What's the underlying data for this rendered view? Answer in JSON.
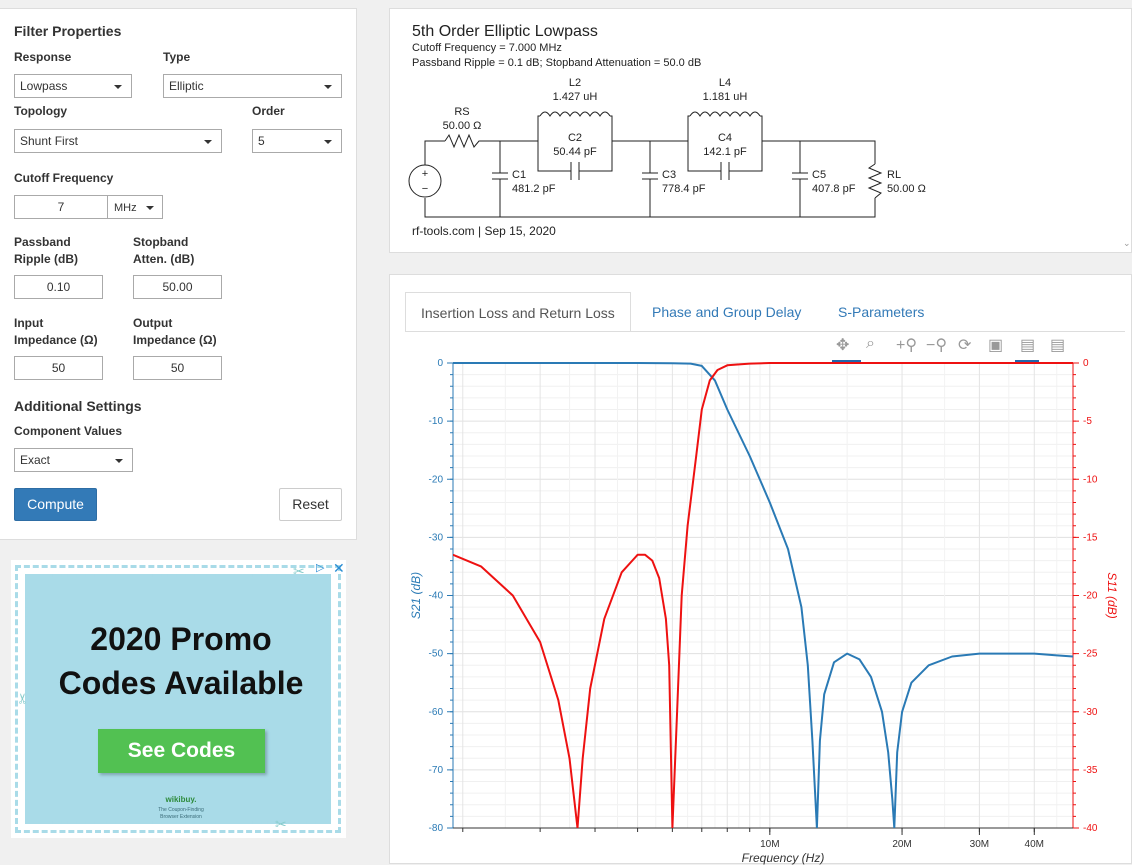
{
  "filter": {
    "heading": "Filter Properties",
    "response_label": "Response",
    "response_value": "Lowpass",
    "type_label": "Type",
    "type_value": "Elliptic",
    "topology_label": "Topology",
    "topology_value": "Shunt First",
    "order_label": "Order",
    "order_value": "5",
    "cutoff_label": "Cutoff Frequency",
    "cutoff_value": "7",
    "cutoff_unit": "MHz",
    "ripple_label_1": "Passband",
    "ripple_label_2": "Ripple (dB)",
    "ripple_value": "0.10",
    "stopband_label_1": "Stopband",
    "stopband_label_2": "Atten. (dB)",
    "stopband_value": "50.00",
    "in_imp_label_1": "Input",
    "in_imp_label_2": "Impedance (Ω)",
    "in_imp_value": "50",
    "out_imp_label_1": "Output",
    "out_imp_label_2": "Impedance (Ω)",
    "out_imp_value": "50",
    "additional_heading": "Additional Settings",
    "component_label": "Component Values",
    "component_value": "Exact",
    "compute_label": "Compute",
    "reset_label": "Reset"
  },
  "ad": {
    "title_1": "2020 Promo",
    "title_2": "Codes Available",
    "button": "See Codes",
    "brand": "wikibuy.",
    "sub_1": "The Coupon-Finding",
    "sub_2": "Browser Extension"
  },
  "schematic": {
    "title": "5th Order Elliptic Lowpass",
    "line1": "Cutoff Frequency = 7.000 MHz",
    "line2": "Passband Ripple = 0.1 dB; Stopband Attenuation = 50.0 dB",
    "footer": "rf-tools.com | Sep 15, 2020",
    "rs_name": "RS",
    "rs_value": "50.00 Ω",
    "l2_name": "L2",
    "l2_value": "1.427 uH",
    "c2_name": "C2",
    "c2_value": "50.44 pF",
    "l4_name": "L4",
    "l4_value": "1.181 uH",
    "c4_name": "C4",
    "c4_value": "142.1 pF",
    "c1_name": "C1",
    "c1_value": "481.2 pF",
    "c3_name": "C3",
    "c3_value": "778.4 pF",
    "c5_name": "C5",
    "c5_value": "407.8 pF",
    "rl_name": "RL",
    "rl_value": "50.00 Ω",
    "src_plus": "+",
    "src_minus": "−"
  },
  "tabs": [
    {
      "label": "Insertion Loss and Return Loss"
    },
    {
      "label": "Phase and Group Delay"
    },
    {
      "label": "S-Parameters"
    }
  ],
  "chart_data": {
    "type": "line",
    "xlabel": "Frequency (Hz)",
    "ylabel": "S21 (dB)",
    "y2label": "S11 (dB)",
    "x_scale": "log",
    "xlim": [
      1900000,
      49000000
    ],
    "x_ticks": [
      {
        "value": 10000000,
        "label": "10M"
      },
      {
        "value": 20000000,
        "label": "20M"
      },
      {
        "value": 30000000,
        "label": "30M"
      },
      {
        "value": 40000000,
        "label": "40M"
      }
    ],
    "ylim": [
      -80,
      0
    ],
    "y_ticks": [
      "0",
      "-10",
      "-20",
      "-30",
      "-40",
      "-50",
      "-60",
      "-70",
      "-80"
    ],
    "y2lim": [
      -40,
      0
    ],
    "y2_ticks": [
      "0",
      "-5",
      "-10",
      "-15",
      "-20",
      "-25",
      "-30",
      "-35",
      "-40"
    ],
    "grid": true,
    "colors": {
      "s21": "#2a7ab5",
      "s11": "#ee1111"
    },
    "series": [
      {
        "axis": "left",
        "x": [
          1900000,
          3000000,
          4000000,
          5000000,
          6000000,
          6600000,
          7000000,
          7500000,
          8000000,
          9000000,
          10000000,
          11000000,
          11800000,
          12200000,
          12500000,
          12800000,
          13000000,
          13300000,
          14000000,
          15000000,
          16000000,
          17000000,
          18000000,
          18600000,
          19000000,
          19200000,
          19500000,
          20000000,
          21000000,
          23000000,
          26000000,
          30000000,
          35000000,
          40000000,
          45000000,
          49000000
        ],
        "y": [
          0,
          0,
          0,
          0,
          -0.05,
          -0.1,
          -0.5,
          -3,
          -8,
          -16,
          -24,
          -32,
          -42,
          -52,
          -65,
          -80,
          -65,
          -57,
          -51.5,
          -50,
          -51,
          -54,
          -60,
          -67,
          -75,
          -80,
          -67,
          -60,
          -55,
          -52,
          -50.5,
          -50,
          -50,
          -50,
          -50.3,
          -50.5
        ]
      },
      {
        "axis": "right",
        "x": [
          1900000,
          2200000,
          2600000,
          3000000,
          3300000,
          3500000,
          3650000,
          3750000,
          3900000,
          4200000,
          4600000,
          5000000,
          5200000,
          5400000,
          5600000,
          5800000,
          5900000,
          6000000,
          6150000,
          6300000,
          6500000,
          6800000,
          7000000,
          7300000,
          7600000,
          8000000,
          9000000,
          10000000,
          15000000,
          20000000,
          30000000,
          49000000
        ],
        "y": [
          -16.5,
          -17.5,
          -20,
          -24,
          -29,
          -34,
          -40,
          -34,
          -28,
          -22,
          -18,
          -16.5,
          -16.5,
          -17,
          -18.5,
          -22,
          -26,
          -40,
          -30,
          -20,
          -14,
          -8,
          -4,
          -1.5,
          -0.6,
          -0.2,
          -0.05,
          0,
          0,
          0,
          0,
          0
        ]
      }
    ]
  }
}
